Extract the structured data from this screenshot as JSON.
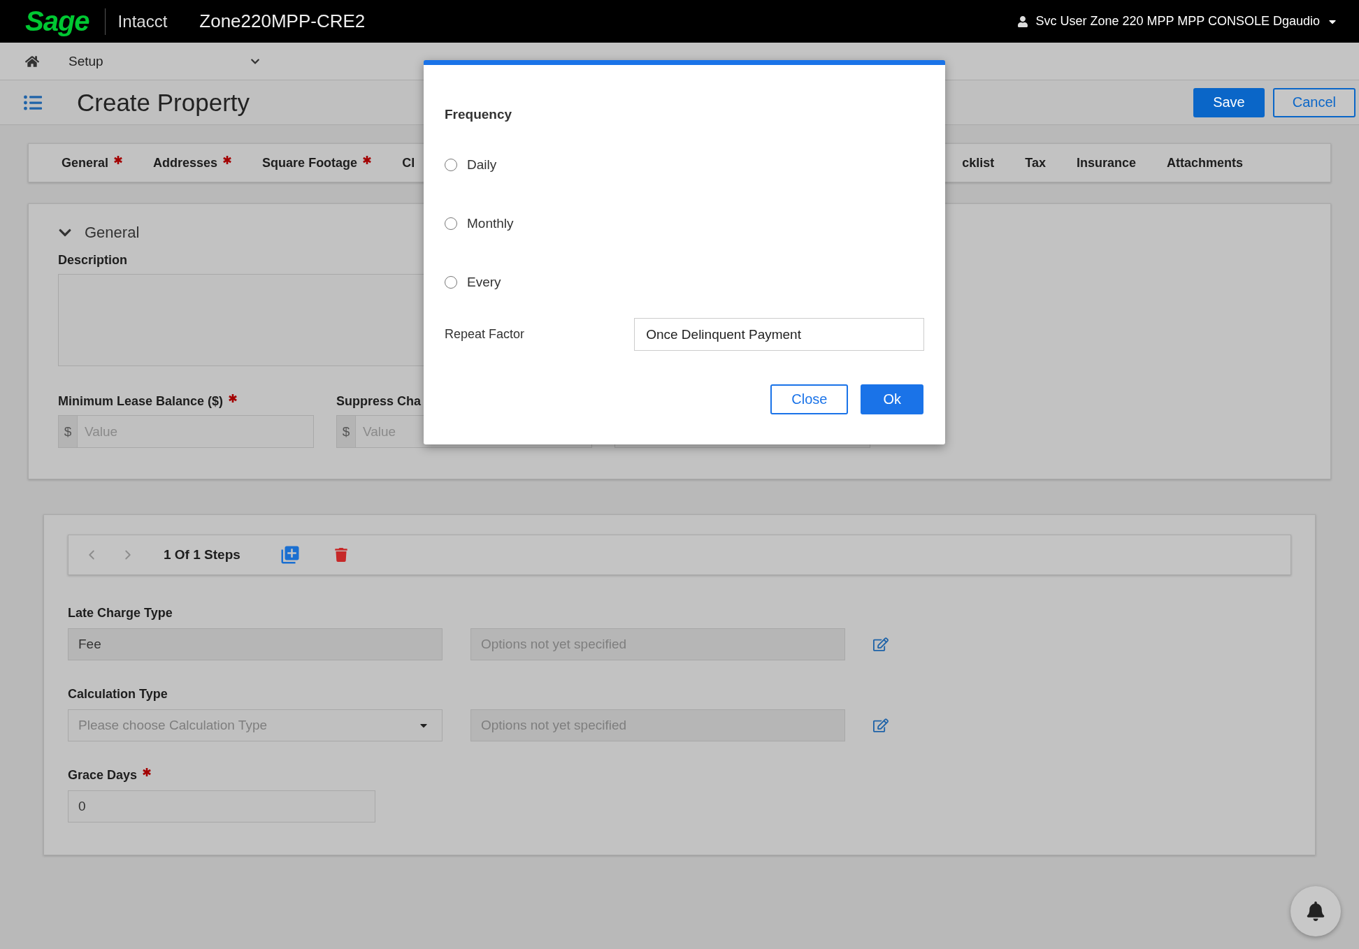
{
  "top_bar": {
    "logo": "Sage",
    "product": "Intacct",
    "company": "Zone220MPP-CRE2",
    "user": "Svc User Zone 220 MPP MPP CONSOLE Dgaudio"
  },
  "nav": {
    "module": "Setup"
  },
  "page": {
    "title": "Create Property",
    "buttons": [
      {
        "label": "Save",
        "kind": "primary"
      },
      {
        "label": "Cancel",
        "kind": "secondary"
      }
    ]
  },
  "tabs_left": [
    {
      "label": "General",
      "required": true,
      "selected": false
    },
    {
      "label": "Addresses",
      "required": true,
      "selected": false
    },
    {
      "label": "Square Footage",
      "required": true,
      "selected": false
    },
    {
      "label": "Cl",
      "required": false,
      "selected": false
    }
  ],
  "tabs_right": [
    {
      "label": "cklist",
      "required": false,
      "selected": false
    },
    {
      "label": "Tax",
      "required": false,
      "selected": false
    },
    {
      "label": "Insurance",
      "required": false,
      "selected": false
    },
    {
      "label": "Attachments",
      "required": false,
      "selected": false
    }
  ],
  "general": {
    "title": "General",
    "expanded": true,
    "description_label": "Description",
    "fields": [
      {
        "label": "Minimum Lease Balance ($)",
        "required": true,
        "prefix": "$",
        "placeholder": "Value"
      },
      {
        "label": "Suppress Cha",
        "prefix": "$",
        "placeholder": "Value"
      }
    ]
  },
  "steps": {
    "counter": "1 Of 1 Steps",
    "prev_disabled": true,
    "next_disabled": true,
    "late_charge_type": {
      "label": "Late Charge Type",
      "value": "Fee",
      "options": "Options not yet specified"
    },
    "calculation_type": {
      "label": "Calculation Type",
      "placeholder": "Please choose Calculation Type",
      "options": "Options not yet specified"
    },
    "grace_days": {
      "label": "Grace Days",
      "required": true,
      "value": "0"
    }
  },
  "dialog": {
    "frequency_label": "Frequency",
    "options": [
      {
        "label": "Daily",
        "selected": false
      },
      {
        "label": "Monthly",
        "selected": false
      },
      {
        "label": "Every",
        "selected": false
      }
    ],
    "repeat_factor": {
      "label": "Repeat Factor",
      "value": "Once Delinquent Payment"
    },
    "buttons": [
      {
        "label": "Close",
        "kind": "secondary"
      },
      {
        "label": "Ok",
        "kind": "primary"
      }
    ]
  }
}
